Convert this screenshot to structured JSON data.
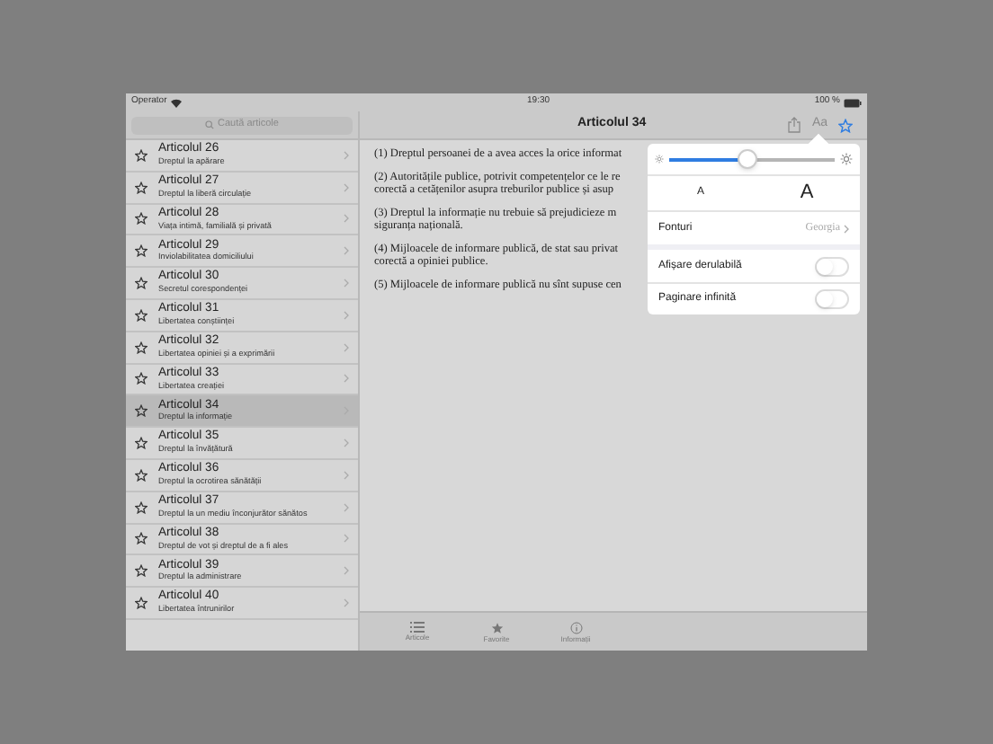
{
  "status_bar": {
    "carrier": "Operator",
    "time": "19:30",
    "battery": "100 %"
  },
  "sidebar": {
    "search": {
      "placeholder": "Caută articole"
    },
    "items": [
      {
        "title": "Articolul 26",
        "subtitle": "Dreptul la apărare",
        "selected": false
      },
      {
        "title": "Articolul 27",
        "subtitle": "Dreptul la liberă circulație",
        "selected": false
      },
      {
        "title": "Articolul 28",
        "subtitle": "Viața intimă, familială și privată",
        "selected": false
      },
      {
        "title": "Articolul 29",
        "subtitle": "Inviolabilitatea domiciliului",
        "selected": false
      },
      {
        "title": "Articolul 30",
        "subtitle": "Secretul corespondenței",
        "selected": false
      },
      {
        "title": "Articolul 31",
        "subtitle": "Libertatea conștiinței",
        "selected": false
      },
      {
        "title": "Articolul 32",
        "subtitle": "Libertatea opiniei și a exprimării",
        "selected": false
      },
      {
        "title": "Articolul 33",
        "subtitle": "Libertatea creației",
        "selected": false
      },
      {
        "title": "Articolul 34",
        "subtitle": "Dreptul la informație",
        "selected": true
      },
      {
        "title": "Articolul 35",
        "subtitle": "Dreptul la învățătură",
        "selected": false
      },
      {
        "title": "Articolul 36",
        "subtitle": "Dreptul la ocrotirea sănătății",
        "selected": false
      },
      {
        "title": "Articolul 37",
        "subtitle": "Dreptul la un mediu înconjurător sănătos",
        "selected": false
      },
      {
        "title": "Articolul 38",
        "subtitle": "Dreptul de vot și dreptul de a fi ales",
        "selected": false
      },
      {
        "title": "Articolul 39",
        "subtitle": "Dreptul la administrare",
        "selected": false
      },
      {
        "title": "Articolul 40",
        "subtitle": "Libertatea întrunirilor",
        "selected": false
      }
    ]
  },
  "article": {
    "title": "Articolul 34",
    "font_button": "Aa",
    "paragraphs": [
      {
        "lines": [
          "(1) Dreptul persoanei de a avea acces la orice informat"
        ]
      },
      {
        "lines": [
          "(2) Autoritățile publice, potrivit competențelor ce le re",
          "corectă a cetățenilor asupra treburilor publice și asup"
        ]
      },
      {
        "lines": [
          "(3) Dreptul la informație nu trebuie să prejudicieze m",
          "siguranța națională."
        ]
      },
      {
        "lines": [
          "(4) Mijloacele de informare publică, de stat sau privat",
          "corectă a opiniei publice."
        ]
      },
      {
        "lines": [
          "(5) Mijloacele de informare publică nu sînt supuse cen"
        ]
      }
    ]
  },
  "popover": {
    "brightness": {
      "level": 0.47
    },
    "font_sizes": [
      {
        "label": "A",
        "kind": "small"
      },
      {
        "label": "A",
        "kind": "large"
      }
    ],
    "font": {
      "label": "Fonturi",
      "value": "Georgia"
    },
    "toggles": [
      {
        "label": "Afișare derulabilă",
        "on": false
      },
      {
        "label": "Paginare infinită",
        "on": false
      }
    ]
  },
  "tab_bar": [
    {
      "label": "Articole",
      "kind": "list"
    },
    {
      "label": "Favorite",
      "kind": "star"
    },
    {
      "label": "Informații",
      "kind": "info"
    }
  ]
}
